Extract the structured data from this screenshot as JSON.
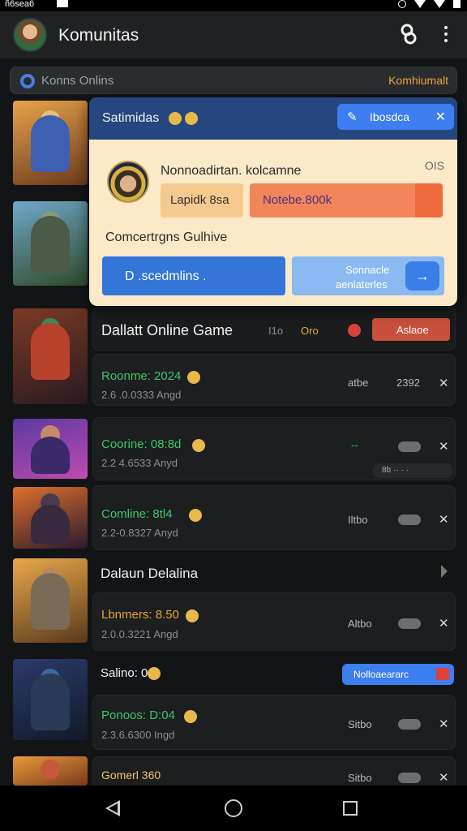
{
  "status": {
    "time": "ñ6sea6"
  },
  "appbar": {
    "title": "Komunitas",
    "avatar": "avatar-icon",
    "link_icon": "link-icon",
    "menu_icon": "more-vert-icon"
  },
  "search": {
    "text": "Konns Onlins",
    "link": "Komhiumalt"
  },
  "popup": {
    "title": "Satimidas",
    "primary_button": "Ibosdca",
    "name": "Nonnoadirtan. kolcamne",
    "meta": "OIS",
    "chip1": "Lapidk 8sa",
    "chip2": "Notebe.800k",
    "section": "Comcertrgns Gulhive",
    "button1": "D .scedmlins .",
    "button2_line1": "Sonnacle",
    "button2_line2": "aenlaterles"
  },
  "rows": [
    {
      "title": "Dallatt Online Game",
      "meta1": "I1o",
      "meta2": "Oro",
      "badge": "Aslaoe"
    },
    {
      "title": "Roonme: 2024",
      "sub": "2.6 .0.0333 Angd",
      "right1": "atbe",
      "right2": "2392"
    },
    {
      "title": "Coorine: 08:8d",
      "sub": "2.2 4.6533 Anyd",
      "right1": "--",
      "tooltip": "8b ·· · ·"
    },
    {
      "title": "Comline: 8tl4",
      "sub": "2.2-0.8327 Anyd",
      "right1": "Iltbo"
    },
    {
      "title": "Dalaun Delalina",
      "section": "Lbnmers: 8.50",
      "sub": "2.0.0.3221 Angd",
      "right1": "Altbo"
    },
    {
      "title": "Salino: 00",
      "badge": "Nolloaeararc",
      "sub_title": "Ponoos: D:04",
      "sub": "2.3.6.6300 Ingd",
      "right1": "Sitbo"
    },
    {
      "title": "Gomerl 360",
      "right1": "Sitbo"
    }
  ],
  "nav": {
    "back": "back-icon",
    "home": "home-icon",
    "recent": "recent-apps-icon"
  }
}
